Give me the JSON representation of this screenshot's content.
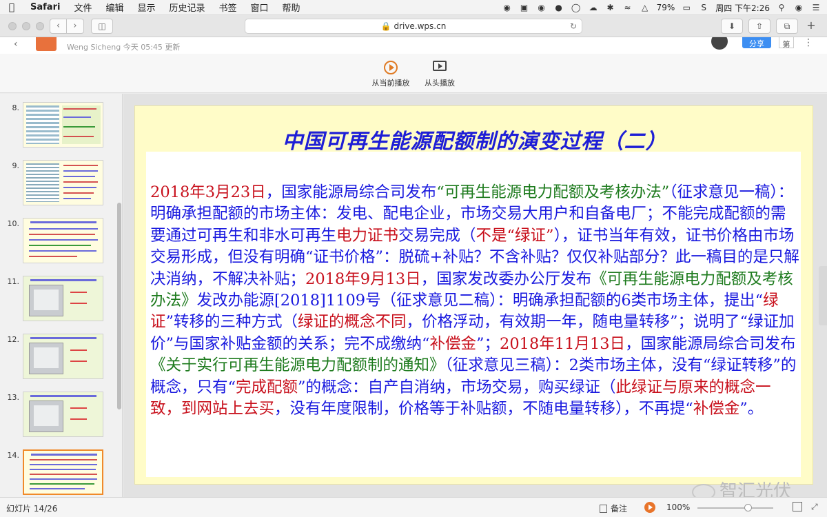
{
  "menubar": {
    "apple_icon": "apple-icon",
    "app_name": "Safari",
    "items": [
      "文件",
      "编辑",
      "显示",
      "历史记录",
      "书签",
      "窗口",
      "帮助"
    ],
    "battery": "79%",
    "clock": "周四 下午2:26"
  },
  "browser": {
    "url": "drive.wps.cn"
  },
  "wps": {
    "author_line": "Weng Sicheng 今天 05:45 更新",
    "share_label": "分享",
    "more_label": "第",
    "btn_play_current": "从当前播放",
    "btn_play_start": "从头播放"
  },
  "thumbnails": [
    {
      "num": "8.",
      "kind": "table"
    },
    {
      "num": "9.",
      "kind": "table-text"
    },
    {
      "num": "10.",
      "kind": "text"
    },
    {
      "num": "11.",
      "kind": "cert"
    },
    {
      "num": "12.",
      "kind": "cert"
    },
    {
      "num": "13.",
      "kind": "cert"
    },
    {
      "num": "14.",
      "kind": "text",
      "active": true
    }
  ],
  "slide": {
    "title": "中国可再生能源配额制的演变过程（二）",
    "segments": [
      {
        "t": "2018年3月23日",
        "c": "red"
      },
      {
        "t": "，国家能源局综合司发布",
        "c": "blue"
      },
      {
        "t": "“可再生能源电力配额及考核办法”",
        "c": "green"
      },
      {
        "t": "（征求意见一稿）：明确承担配额的市场主体：发电、配电企业，市场交易大用户和自备电厂；不能完成配额的需要通过可再生和非水可再生",
        "c": "blue"
      },
      {
        "t": "电力证书",
        "c": "red"
      },
      {
        "t": "交易完成（",
        "c": "blue"
      },
      {
        "t": "不是“绿证”",
        "c": "red"
      },
      {
        "t": "），证书当年有效，证书价格由市场交易形成，但没有明确“证书价格”：脱硫+补贴？不含补贴？仅仅补贴部分？此一稿目的是只解决消纳，不解决补贴；",
        "c": "blue"
      },
      {
        "t": "2018年9月13日",
        "c": "red"
      },
      {
        "t": "，国家发改委办公厅发布",
        "c": "blue"
      },
      {
        "t": "《可再生能源电力配额及考核办法》",
        "c": "green"
      },
      {
        "t": "发改办能源[2018]1109号（征求意见二稿）：明确承担配额的6类市场主体，提出“",
        "c": "blue"
      },
      {
        "t": "绿证",
        "c": "red"
      },
      {
        "t": "”转移的三种方式（",
        "c": "blue"
      },
      {
        "t": "绿证的概念不同",
        "c": "red"
      },
      {
        "t": "，价格浮动，有效期一年，随电量转移”；说明了“绿证加价”与国家补贴金额的关系；完不成缴纳“",
        "c": "blue"
      },
      {
        "t": "补偿金",
        "c": "red"
      },
      {
        "t": "”；",
        "c": "blue"
      },
      {
        "t": "2018年11月13日",
        "c": "red"
      },
      {
        "t": "，国家能源局综合司发布",
        "c": "blue"
      },
      {
        "t": "《关于实行可再生能源电力配额制的通知》",
        "c": "green"
      },
      {
        "t": "（征求意见三稿）：2类市场主体，没有“绿证转移”的概念，只有“",
        "c": "blue"
      },
      {
        "t": "完成配额",
        "c": "red"
      },
      {
        "t": "”的概念：自产自消纳，市场交易，购买绿证（",
        "c": "blue"
      },
      {
        "t": "此绿证与原来的概念一致，到网站上去买",
        "c": "red"
      },
      {
        "t": "，没有年度限制，价格等于补贴额，不随电量转移），不再提“",
        "c": "blue"
      },
      {
        "t": "补偿金",
        "c": "red"
      },
      {
        "t": "”。",
        "c": "blue"
      }
    ],
    "watermark": "智汇光伏"
  },
  "status": {
    "page": "幻灯片 14/26",
    "notes": "备注",
    "zoom": "100%",
    "zoom_level": 0.66
  }
}
